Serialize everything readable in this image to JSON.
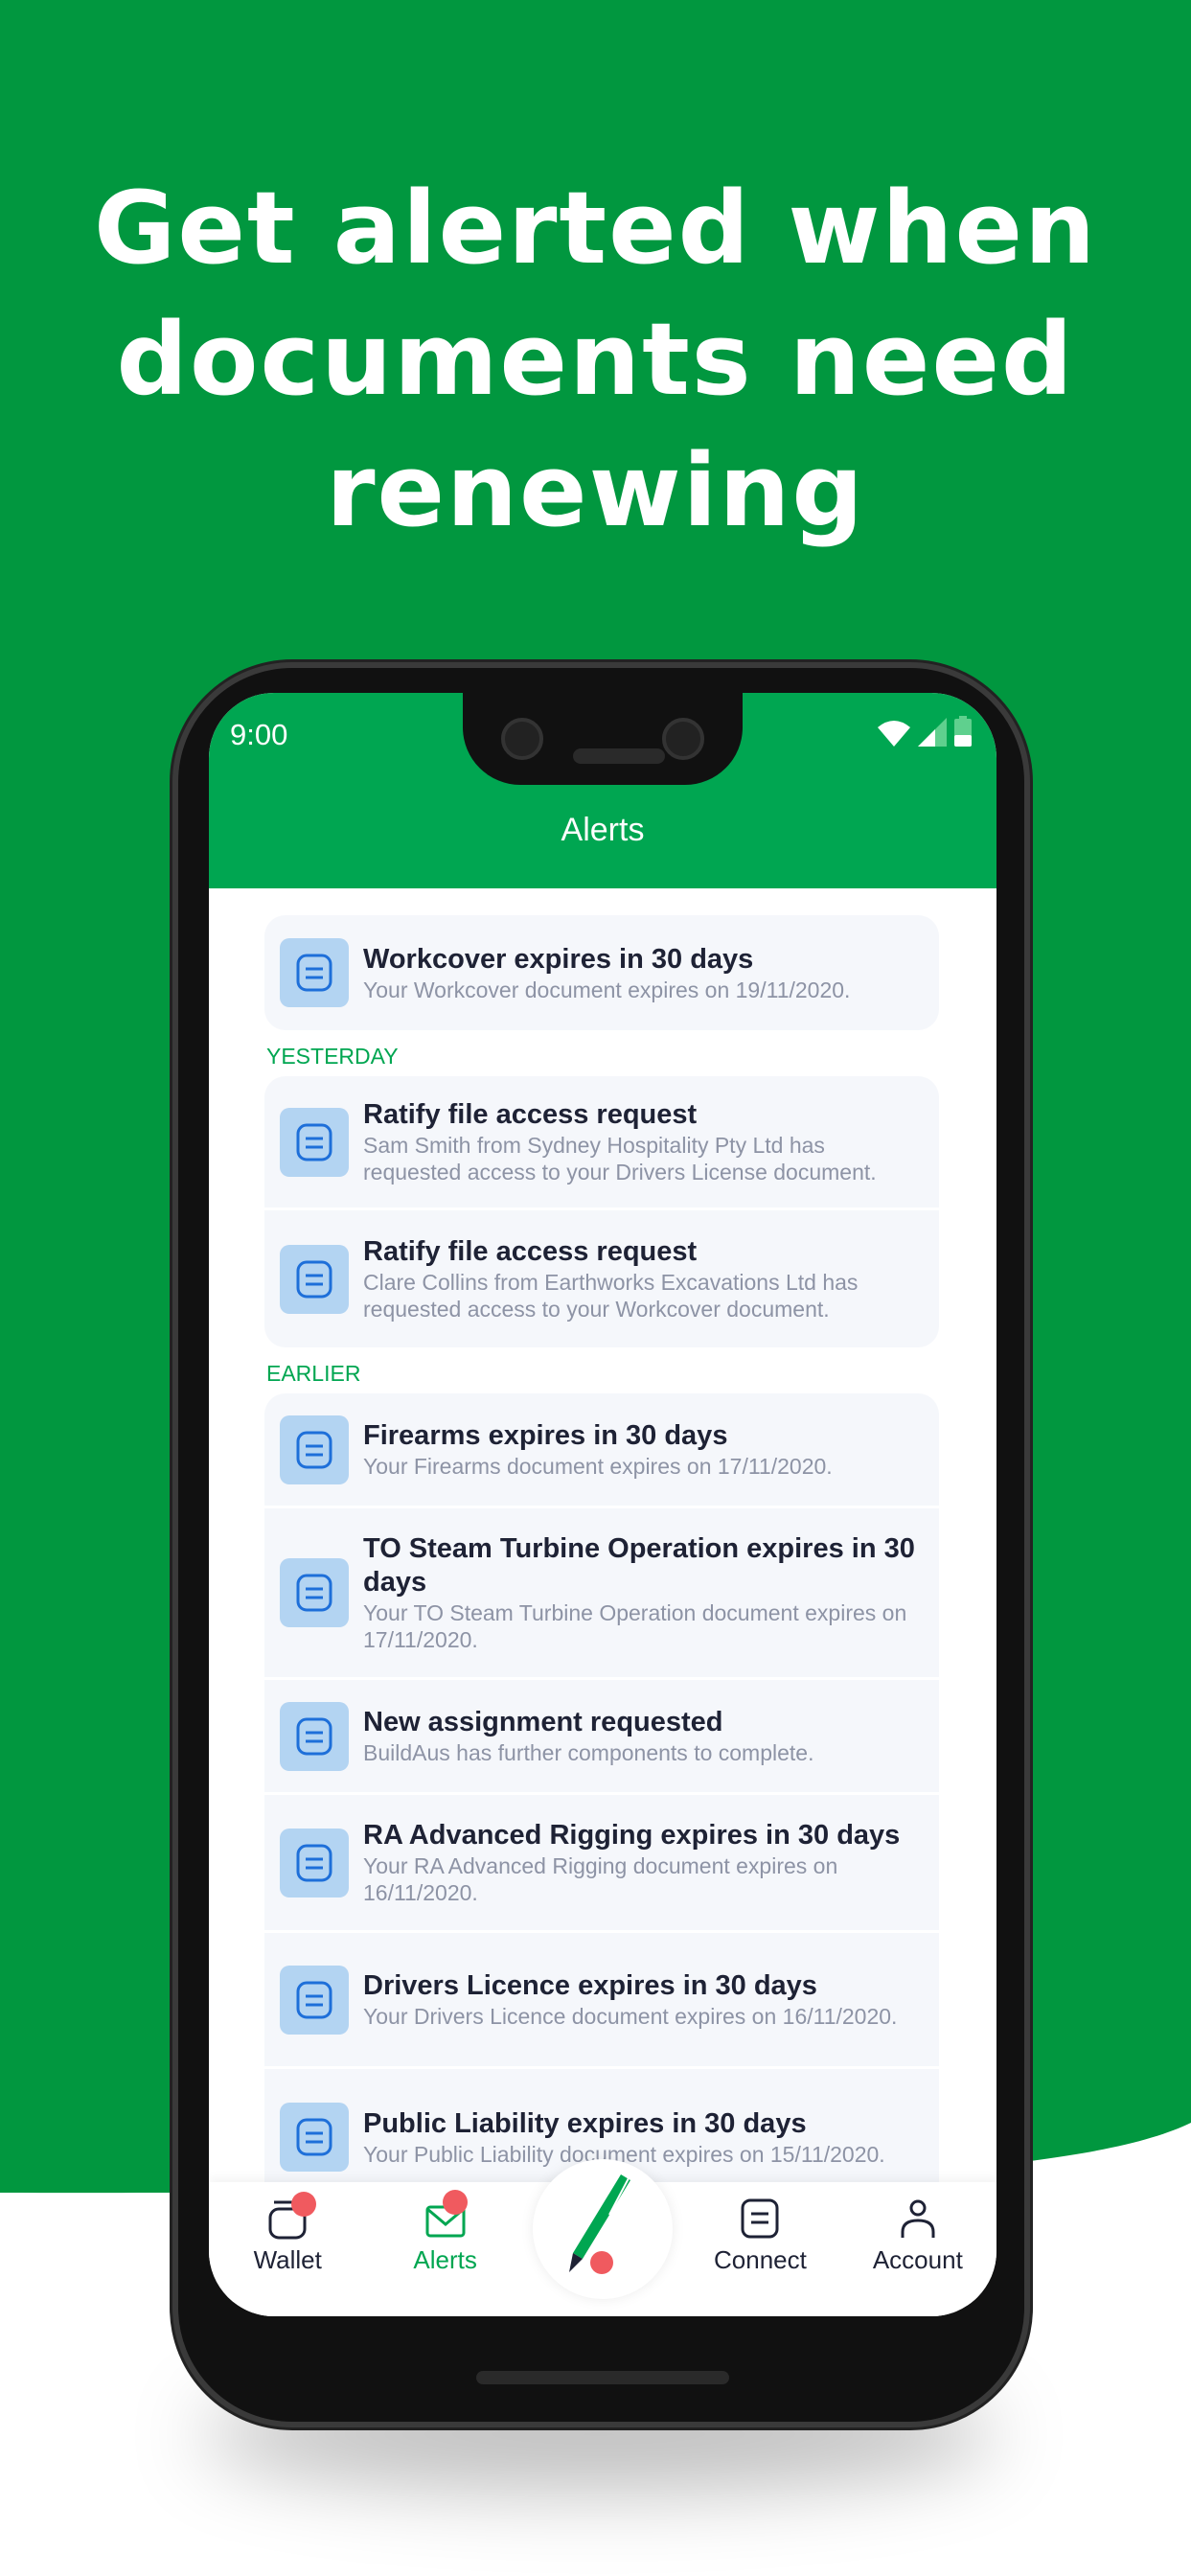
{
  "colors": {
    "brand_green": "#00a651",
    "badge_red": "#f05a5f",
    "icon_bg": "#b3d4f2",
    "icon_blue": "#1e6fd9"
  },
  "headline": [
    "Get alerted when",
    "documents need",
    "renewing"
  ],
  "status_bar": {
    "time": "9:00",
    "icons": [
      "wifi-icon",
      "signal-icon",
      "battery-icon"
    ]
  },
  "header": {
    "title": "Alerts"
  },
  "alerts": {
    "top": [
      {
        "title": "Workcover expires in 30 days",
        "subtitle": "Your Workcover document expires on 19/11/2020."
      }
    ],
    "yesterday_label": "YESTERDAY",
    "yesterday": [
      {
        "title": "Ratify file access request",
        "subtitle": "Sam Smith from Sydney Hospitality Pty Ltd has requested access to your Drivers License document."
      },
      {
        "title": "Ratify file access request",
        "subtitle": "Clare Collins from Earthworks Excavations Ltd has requested access to your Workcover document."
      }
    ],
    "earlier_label": "EARLIER",
    "earlier": [
      {
        "title": "Firearms expires in 30 days",
        "subtitle": "Your Firearms document expires on 17/11/2020."
      },
      {
        "title": "TO Steam Turbine Operation expires in 30 days",
        "subtitle": "Your TO Steam Turbine Operation document expires on 17/11/2020."
      },
      {
        "title": "New assignment requested",
        "subtitle": "BuildAus has further components to complete."
      },
      {
        "title": "RA Advanced Rigging expires in 30 days",
        "subtitle": "Your RA Advanced Rigging document expires on 16/11/2020."
      },
      {
        "title": "Drivers Licence expires in 30 days",
        "subtitle": "Your Drivers Licence document expires on 16/11/2020."
      },
      {
        "title": "Public Liability expires in 30 days",
        "subtitle": "Your Public Liability document expires on 15/11/2020."
      }
    ]
  },
  "nav": {
    "wallet": "Wallet",
    "alerts": "Alerts",
    "connect": "Connect",
    "account": "Account",
    "active": "alerts"
  }
}
